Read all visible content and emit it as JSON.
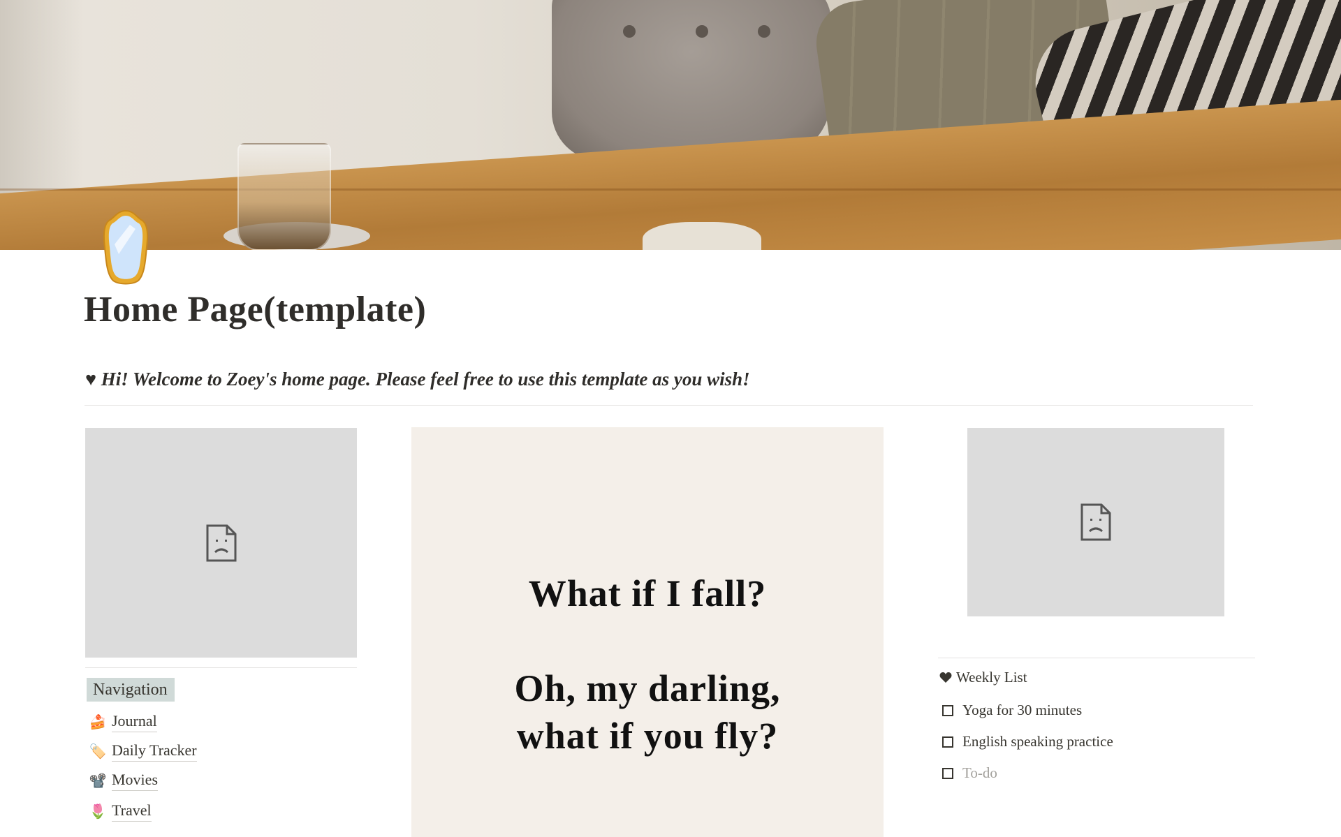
{
  "page": {
    "title": "Home Page(template)",
    "icon": "mirror-icon",
    "welcome_prefix": "♥",
    "welcome": "Hi! Welcome to Zoey's home page. Please feel free to use this template as you wish!"
  },
  "images": {
    "left": {
      "icon": "broken-image-icon"
    },
    "right": {
      "icon": "broken-image-icon"
    }
  },
  "quote": {
    "line1": "What if I fall?",
    "line2a": "Oh, my darling,",
    "line2b": "what if you fly?"
  },
  "navigation": {
    "heading": "Navigation",
    "items": [
      {
        "label": "Journal",
        "emoji": "🍰",
        "icon": "cake-icon"
      },
      {
        "label": "Daily Tracker",
        "emoji": "🏷️",
        "icon": "tag-icon"
      },
      {
        "label": "Movies",
        "emoji": "📽️",
        "icon": "film-projector-icon"
      },
      {
        "label": "Travel",
        "emoji": "🌷",
        "icon": "tulip-icon"
      }
    ]
  },
  "weekly": {
    "heading": "Weekly List",
    "heading_icon": "heart-icon",
    "items": [
      {
        "label": "Yoga for 30 minutes",
        "checked": false
      },
      {
        "label": "English speaking practice",
        "checked": false
      }
    ],
    "new_item_placeholder": "To-do"
  },
  "colors": {
    "nav_highlight": "#d0dad8",
    "quote_card_bg": "#f4efe9",
    "placeholder_bg": "#dcdcdc",
    "text": "#37352f"
  }
}
